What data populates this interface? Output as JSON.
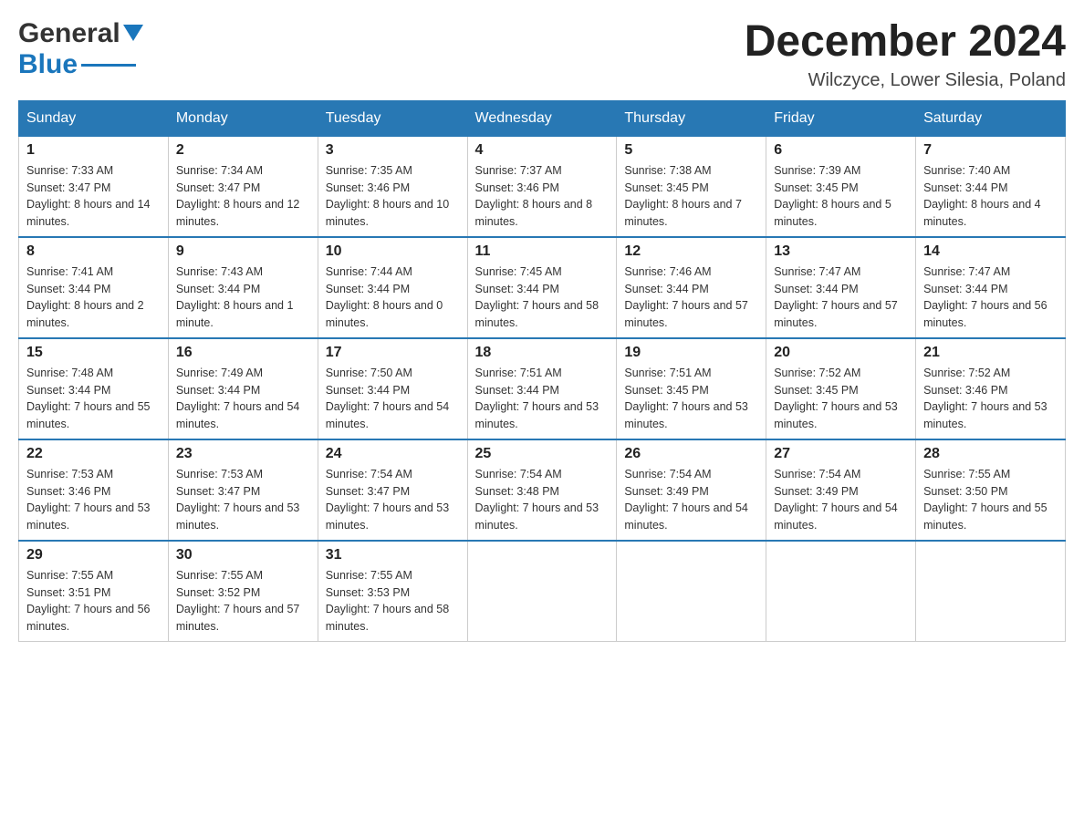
{
  "header": {
    "month_title": "December 2024",
    "location": "Wilczyce, Lower Silesia, Poland",
    "logo_general": "General",
    "logo_blue": "Blue"
  },
  "weekdays": [
    "Sunday",
    "Monday",
    "Tuesday",
    "Wednesday",
    "Thursday",
    "Friday",
    "Saturday"
  ],
  "weeks": [
    [
      {
        "day": "1",
        "sunrise": "Sunrise: 7:33 AM",
        "sunset": "Sunset: 3:47 PM",
        "daylight": "Daylight: 8 hours and 14 minutes."
      },
      {
        "day": "2",
        "sunrise": "Sunrise: 7:34 AM",
        "sunset": "Sunset: 3:47 PM",
        "daylight": "Daylight: 8 hours and 12 minutes."
      },
      {
        "day": "3",
        "sunrise": "Sunrise: 7:35 AM",
        "sunset": "Sunset: 3:46 PM",
        "daylight": "Daylight: 8 hours and 10 minutes."
      },
      {
        "day": "4",
        "sunrise": "Sunrise: 7:37 AM",
        "sunset": "Sunset: 3:46 PM",
        "daylight": "Daylight: 8 hours and 8 minutes."
      },
      {
        "day": "5",
        "sunrise": "Sunrise: 7:38 AM",
        "sunset": "Sunset: 3:45 PM",
        "daylight": "Daylight: 8 hours and 7 minutes."
      },
      {
        "day": "6",
        "sunrise": "Sunrise: 7:39 AM",
        "sunset": "Sunset: 3:45 PM",
        "daylight": "Daylight: 8 hours and 5 minutes."
      },
      {
        "day": "7",
        "sunrise": "Sunrise: 7:40 AM",
        "sunset": "Sunset: 3:44 PM",
        "daylight": "Daylight: 8 hours and 4 minutes."
      }
    ],
    [
      {
        "day": "8",
        "sunrise": "Sunrise: 7:41 AM",
        "sunset": "Sunset: 3:44 PM",
        "daylight": "Daylight: 8 hours and 2 minutes."
      },
      {
        "day": "9",
        "sunrise": "Sunrise: 7:43 AM",
        "sunset": "Sunset: 3:44 PM",
        "daylight": "Daylight: 8 hours and 1 minute."
      },
      {
        "day": "10",
        "sunrise": "Sunrise: 7:44 AM",
        "sunset": "Sunset: 3:44 PM",
        "daylight": "Daylight: 8 hours and 0 minutes."
      },
      {
        "day": "11",
        "sunrise": "Sunrise: 7:45 AM",
        "sunset": "Sunset: 3:44 PM",
        "daylight": "Daylight: 7 hours and 58 minutes."
      },
      {
        "day": "12",
        "sunrise": "Sunrise: 7:46 AM",
        "sunset": "Sunset: 3:44 PM",
        "daylight": "Daylight: 7 hours and 57 minutes."
      },
      {
        "day": "13",
        "sunrise": "Sunrise: 7:47 AM",
        "sunset": "Sunset: 3:44 PM",
        "daylight": "Daylight: 7 hours and 57 minutes."
      },
      {
        "day": "14",
        "sunrise": "Sunrise: 7:47 AM",
        "sunset": "Sunset: 3:44 PM",
        "daylight": "Daylight: 7 hours and 56 minutes."
      }
    ],
    [
      {
        "day": "15",
        "sunrise": "Sunrise: 7:48 AM",
        "sunset": "Sunset: 3:44 PM",
        "daylight": "Daylight: 7 hours and 55 minutes."
      },
      {
        "day": "16",
        "sunrise": "Sunrise: 7:49 AM",
        "sunset": "Sunset: 3:44 PM",
        "daylight": "Daylight: 7 hours and 54 minutes."
      },
      {
        "day": "17",
        "sunrise": "Sunrise: 7:50 AM",
        "sunset": "Sunset: 3:44 PM",
        "daylight": "Daylight: 7 hours and 54 minutes."
      },
      {
        "day": "18",
        "sunrise": "Sunrise: 7:51 AM",
        "sunset": "Sunset: 3:44 PM",
        "daylight": "Daylight: 7 hours and 53 minutes."
      },
      {
        "day": "19",
        "sunrise": "Sunrise: 7:51 AM",
        "sunset": "Sunset: 3:45 PM",
        "daylight": "Daylight: 7 hours and 53 minutes."
      },
      {
        "day": "20",
        "sunrise": "Sunrise: 7:52 AM",
        "sunset": "Sunset: 3:45 PM",
        "daylight": "Daylight: 7 hours and 53 minutes."
      },
      {
        "day": "21",
        "sunrise": "Sunrise: 7:52 AM",
        "sunset": "Sunset: 3:46 PM",
        "daylight": "Daylight: 7 hours and 53 minutes."
      }
    ],
    [
      {
        "day": "22",
        "sunrise": "Sunrise: 7:53 AM",
        "sunset": "Sunset: 3:46 PM",
        "daylight": "Daylight: 7 hours and 53 minutes."
      },
      {
        "day": "23",
        "sunrise": "Sunrise: 7:53 AM",
        "sunset": "Sunset: 3:47 PM",
        "daylight": "Daylight: 7 hours and 53 minutes."
      },
      {
        "day": "24",
        "sunrise": "Sunrise: 7:54 AM",
        "sunset": "Sunset: 3:47 PM",
        "daylight": "Daylight: 7 hours and 53 minutes."
      },
      {
        "day": "25",
        "sunrise": "Sunrise: 7:54 AM",
        "sunset": "Sunset: 3:48 PM",
        "daylight": "Daylight: 7 hours and 53 minutes."
      },
      {
        "day": "26",
        "sunrise": "Sunrise: 7:54 AM",
        "sunset": "Sunset: 3:49 PM",
        "daylight": "Daylight: 7 hours and 54 minutes."
      },
      {
        "day": "27",
        "sunrise": "Sunrise: 7:54 AM",
        "sunset": "Sunset: 3:49 PM",
        "daylight": "Daylight: 7 hours and 54 minutes."
      },
      {
        "day": "28",
        "sunrise": "Sunrise: 7:55 AM",
        "sunset": "Sunset: 3:50 PM",
        "daylight": "Daylight: 7 hours and 55 minutes."
      }
    ],
    [
      {
        "day": "29",
        "sunrise": "Sunrise: 7:55 AM",
        "sunset": "Sunset: 3:51 PM",
        "daylight": "Daylight: 7 hours and 56 minutes."
      },
      {
        "day": "30",
        "sunrise": "Sunrise: 7:55 AM",
        "sunset": "Sunset: 3:52 PM",
        "daylight": "Daylight: 7 hours and 57 minutes."
      },
      {
        "day": "31",
        "sunrise": "Sunrise: 7:55 AM",
        "sunset": "Sunset: 3:53 PM",
        "daylight": "Daylight: 7 hours and 58 minutes."
      },
      null,
      null,
      null,
      null
    ]
  ]
}
